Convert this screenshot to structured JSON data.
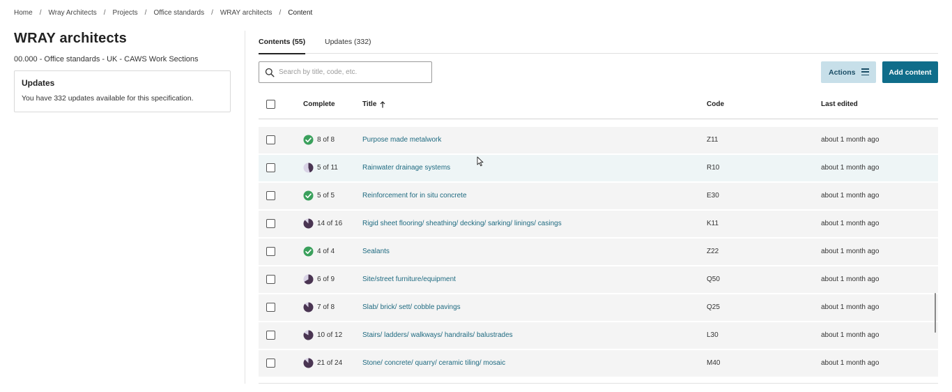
{
  "breadcrumb": [
    "Home",
    "Wray Architects",
    "Projects",
    "Office standards",
    "WRAY architects",
    "Content"
  ],
  "page": {
    "title": "WRAY architects",
    "subtitle": "00.000 - Office standards - UK - CAWS Work Sections"
  },
  "updates_card": {
    "title": "Updates",
    "text": "You have 332 updates available for this specification."
  },
  "tabs": [
    {
      "label": "Contents (55)",
      "active": true
    },
    {
      "label": "Updates (332)",
      "active": false
    }
  ],
  "search": {
    "placeholder": "Search by title, code, etc.",
    "value": ""
  },
  "toolbar": {
    "actions_label": "Actions",
    "add_label": "Add content"
  },
  "colors": {
    "primary": "#0f6d8a",
    "secondary": "#c7dfe9",
    "link": "#1e6a80",
    "complete": "#3aa05c",
    "progress": "#4a3552"
  },
  "table": {
    "headers": {
      "complete": "Complete",
      "title": "Title",
      "code": "Code",
      "last_edited": "Last edited"
    },
    "sort": {
      "column": "Title",
      "direction": "ascending"
    },
    "rows": [
      {
        "done": 8,
        "total": 8,
        "complete": "8 of 8",
        "title": "Purpose made metalwork",
        "code": "Z11",
        "edited": "about 1 month ago"
      },
      {
        "done": 5,
        "total": 11,
        "complete": "5 of 11",
        "title": "Rainwater drainage systems",
        "code": "R10",
        "edited": "about 1 month ago"
      },
      {
        "done": 5,
        "total": 5,
        "complete": "5 of 5",
        "title": "Reinforcement for in situ concrete",
        "code": "E30",
        "edited": "about 1 month ago"
      },
      {
        "done": 14,
        "total": 16,
        "complete": "14 of 16",
        "title": "Rigid sheet flooring/ sheathing/ decking/ sarking/ linings/ casings",
        "code": "K11",
        "edited": "about 1 month ago"
      },
      {
        "done": 4,
        "total": 4,
        "complete": "4 of 4",
        "title": "Sealants",
        "code": "Z22",
        "edited": "about 1 month ago"
      },
      {
        "done": 6,
        "total": 9,
        "complete": "6 of 9",
        "title": "Site/street furniture/equipment",
        "code": "Q50",
        "edited": "about 1 month ago"
      },
      {
        "done": 7,
        "total": 8,
        "complete": "7 of 8",
        "title": "Slab/ brick/ sett/ cobble pavings",
        "code": "Q25",
        "edited": "about 1 month ago"
      },
      {
        "done": 10,
        "total": 12,
        "complete": "10 of 12",
        "title": "Stairs/ ladders/ walkways/ handrails/ balustrades",
        "code": "L30",
        "edited": "about 1 month ago"
      },
      {
        "done": 21,
        "total": 24,
        "complete": "21 of 24",
        "title": "Stone/ concrete/ quarry/ ceramic tiling/ mosaic",
        "code": "M40",
        "edited": "about 1 month ago"
      }
    ]
  }
}
